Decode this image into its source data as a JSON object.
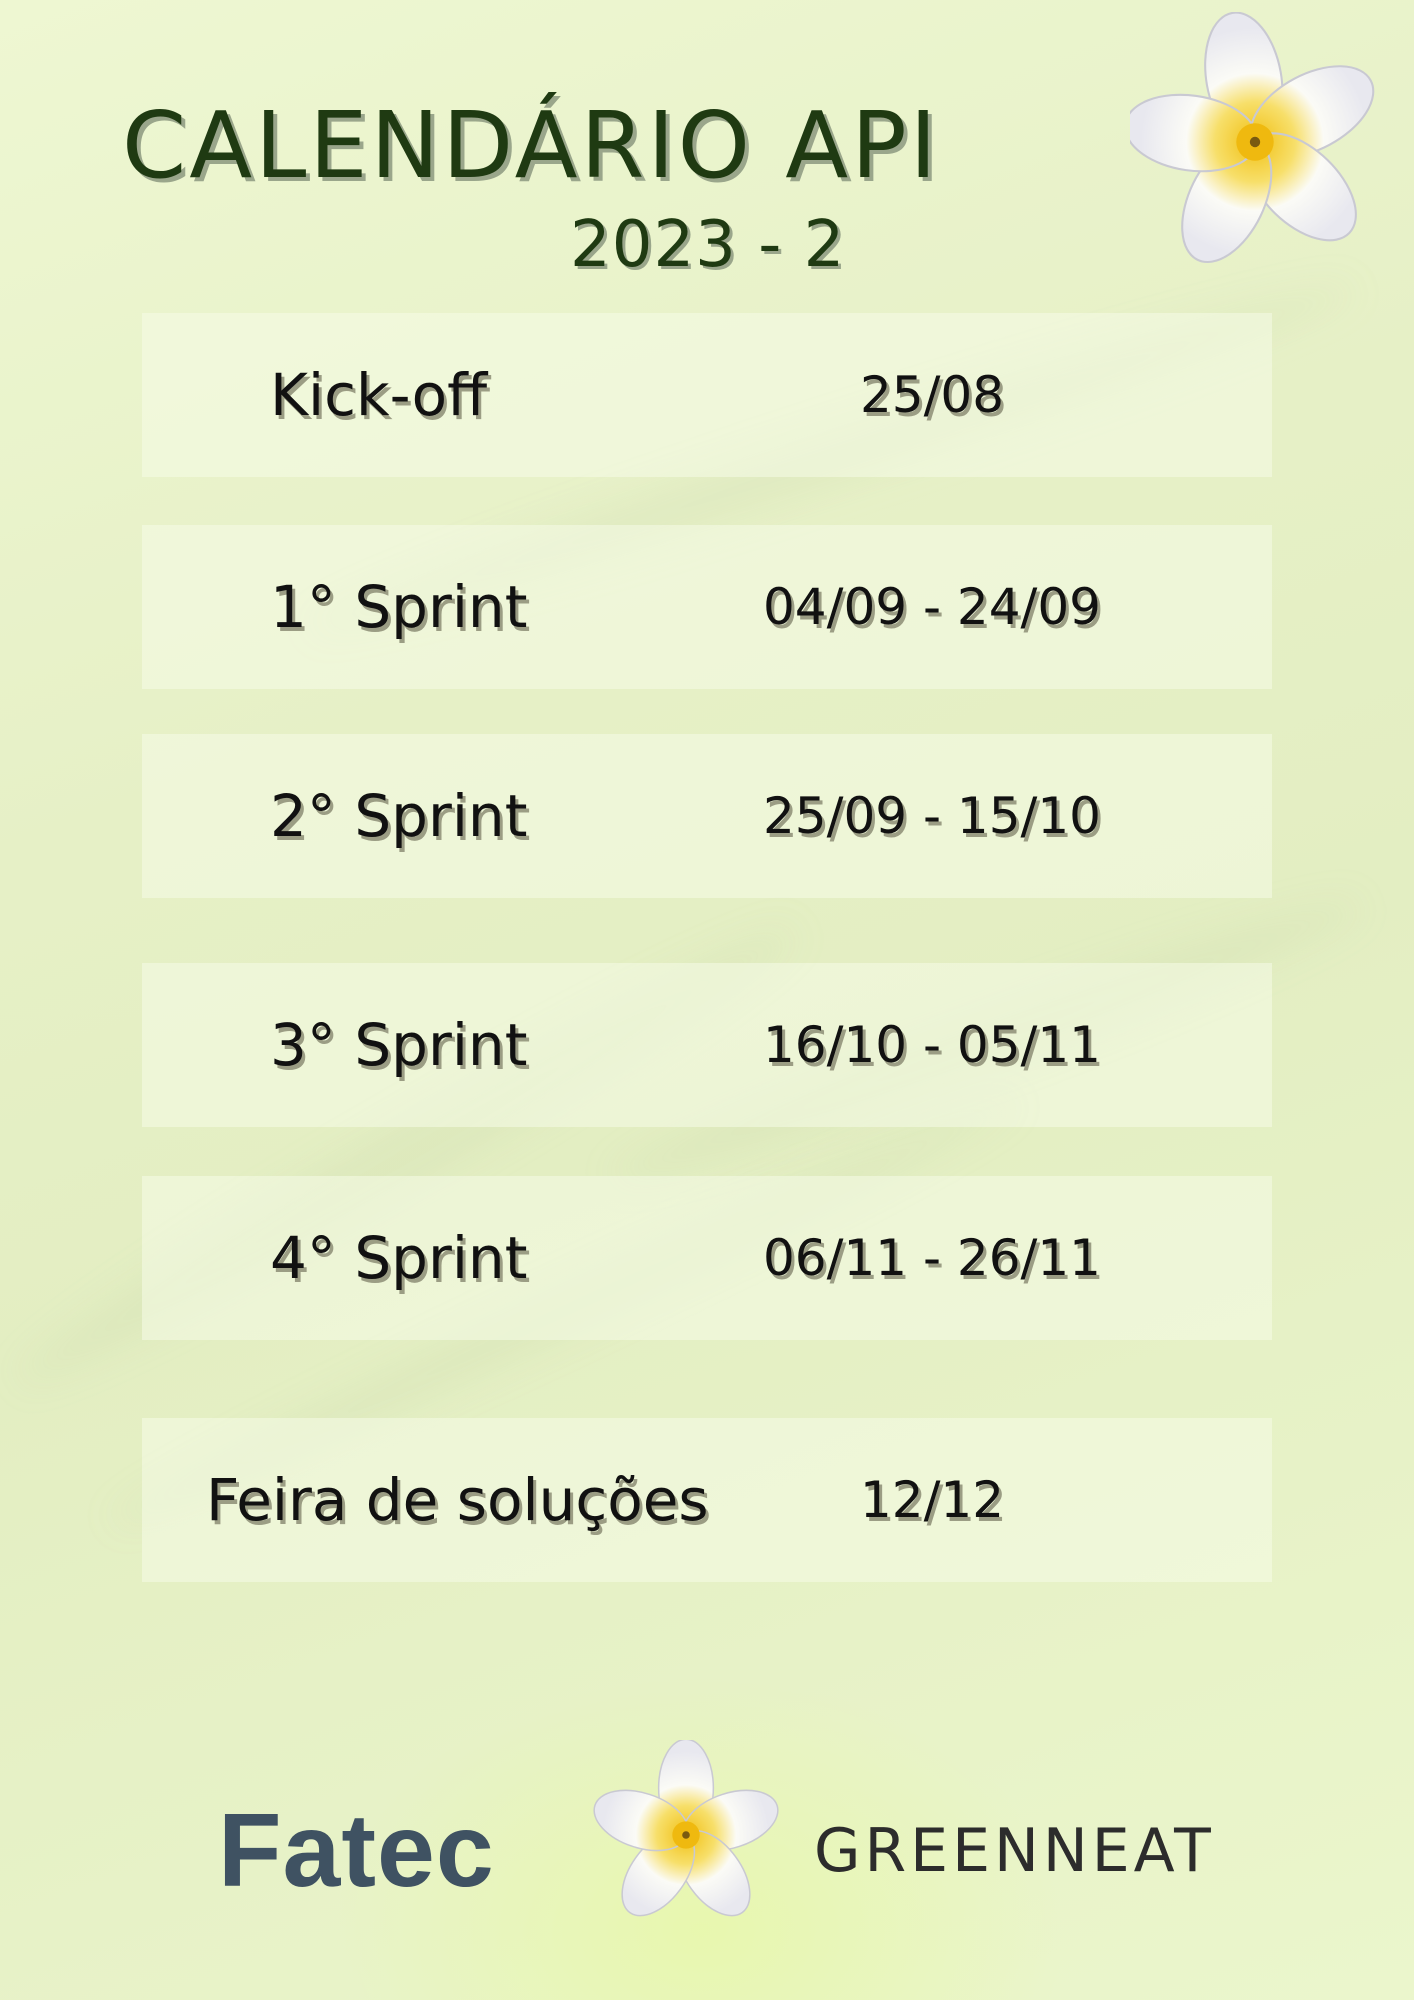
{
  "header": {
    "title": "CALENDÁRIO API",
    "subtitle": "2023 - 2"
  },
  "schedule": [
    {
      "label": "Kick-off",
      "date": "25/08"
    },
    {
      "label": "1° Sprint",
      "date": "04/09 - 24/09"
    },
    {
      "label": "2° Sprint",
      "date": "25/09 - 15/10"
    },
    {
      "label": "3° Sprint",
      "date": "16/10 - 05/11"
    },
    {
      "label": "4° Sprint",
      "date": "06/11 - 26/11"
    },
    {
      "label": "Feira de soluções",
      "date": "12/12"
    }
  ],
  "footer": {
    "fatec": "Fatec",
    "greenneat": "GREENNEAT"
  },
  "colors": {
    "title": "#1f3a12",
    "fatec": "#3f5262",
    "background": "#e6f0c6"
  },
  "icons": [
    "plumeria-flower-icon"
  ]
}
